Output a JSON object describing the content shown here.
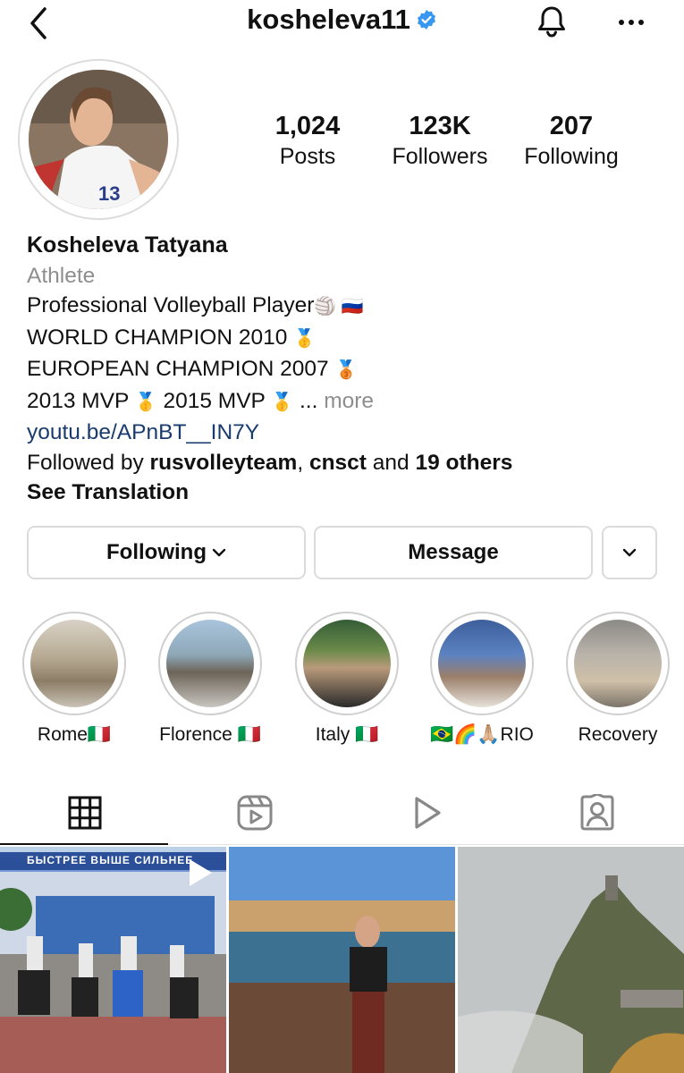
{
  "header": {
    "username": "kosheleva11",
    "icons": {
      "back": "chevron-left-icon",
      "verified": "verified-badge-icon",
      "notifications": "bell-icon",
      "more": "more-horizontal-icon"
    }
  },
  "stats": {
    "posts": {
      "value": "1,024",
      "label": "Posts"
    },
    "followers": {
      "value": "123K",
      "label": "Followers"
    },
    "following": {
      "value": "207",
      "label": "Following"
    }
  },
  "bio": {
    "name": "Kosheleva Tatyana",
    "category": "Athlete",
    "line1": "Professional Volleyball Player",
    "line1_emoji": "🏐 🇷🇺",
    "line2": "WORLD CHAMPION 2010",
    "line2_emoji": "🥇",
    "line3": "EUROPEAN CHAMPION 2007",
    "line3_emoji": "🥉",
    "line4a": "2013 MVP",
    "line4b": "2015 MVP",
    "line4_emoji": "🥇",
    "ellipsis": "...",
    "more": "more",
    "link": "youtu.be/APnBT__IN7Y",
    "followed_by_prefix": "Followed by",
    "followed_by_user1": "rusvolleyteam",
    "followed_by_sep": ",",
    "followed_by_user2": "cnsct",
    "followed_by_and": "and",
    "followed_by_others": "19 others",
    "see_translation": "See Translation"
  },
  "buttons": {
    "following": "Following",
    "message": "Message"
  },
  "highlights": [
    {
      "caption": "Rome🇮🇹"
    },
    {
      "caption": "Florence 🇮🇹"
    },
    {
      "caption": "Italy 🇮🇹"
    },
    {
      "caption": "🇧🇷🌈🙏🏼RIO"
    },
    {
      "caption": "Recovery"
    }
  ],
  "tabs": [
    "grid-icon",
    "reels-icon",
    "play-icon",
    "tagged-icon"
  ],
  "active_tab": "grid",
  "posts_grid": {
    "tile0_sign": "БЫСТРЕЕ ВЫШЕ СИЛЬНЕЕ"
  }
}
